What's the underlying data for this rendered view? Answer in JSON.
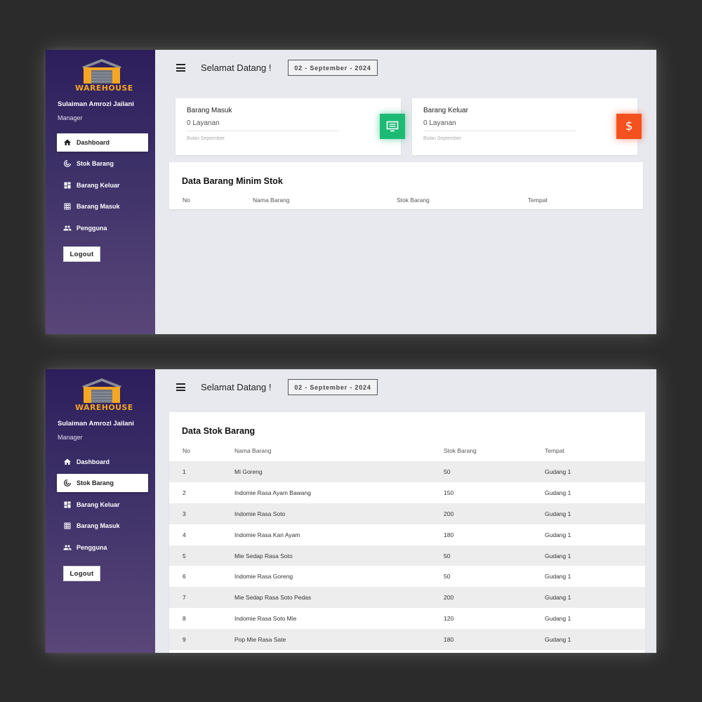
{
  "brand": "WAREHOUSE",
  "user": {
    "name": "Sulaiman Amrozi Jailani",
    "role": "Manager"
  },
  "nav": [
    {
      "label": "Dashboard",
      "icon": "home-icon"
    },
    {
      "label": "Stok Barang",
      "icon": "radar-icon"
    },
    {
      "label": "Barang Keluar",
      "icon": "dashboard-grid-icon"
    },
    {
      "label": "Barang Masuk",
      "icon": "table-grid-icon"
    },
    {
      "label": "Pengguna",
      "icon": "people-icon"
    }
  ],
  "logout_label": "Logout",
  "header": {
    "welcome": "Selamat Datang !",
    "date": "02 - September - 2024"
  },
  "dashboard": {
    "active_nav": "Dashboard",
    "cards": [
      {
        "title": "Barang Masuk",
        "value": "0 Layanan",
        "note": "Bulan September",
        "icon": "monitor-icon",
        "color": "#1dba76"
      },
      {
        "title": "Barang Keluar",
        "value": "0 Layanan",
        "note": "Bulan September",
        "icon": "dollar-icon",
        "color": "#f4511e"
      }
    ],
    "min_stock": {
      "title": "Data Barang Minim Stok",
      "columns": [
        "No",
        "Nama Barang",
        "Stok Barang",
        "Tempat"
      ]
    }
  },
  "stock_page": {
    "active_nav": "Stok Barang",
    "title": "Data Stok Barang",
    "columns": [
      "No",
      "Nama Barang",
      "Stok Barang",
      "Tempat"
    ],
    "rows": [
      [
        "1",
        "Mi Goreng",
        "50",
        "Gudang 1"
      ],
      [
        "2",
        "Indomie Rasa Ayam Bawang",
        "150",
        "Gudang 1"
      ],
      [
        "3",
        "Indomie Rasa Soto",
        "200",
        "Gudang 1"
      ],
      [
        "4",
        "Indomie Rasa Kari Ayam",
        "180",
        "Gudang 1"
      ],
      [
        "5",
        "Mie Sedap Rasa Soto",
        "50",
        "Gudang 1"
      ],
      [
        "6",
        "Indomie Rasa Goreng",
        "50",
        "Gudang 1"
      ],
      [
        "7",
        "Mie Sedap Rasa Soto Pedas",
        "200",
        "Gudang 1"
      ],
      [
        "8",
        "Indomie Rasa Soto Mie",
        "120",
        "Gudang 1"
      ],
      [
        "9",
        "Pop Mie Rasa Sate",
        "180",
        "Gudang 1"
      ]
    ]
  }
}
